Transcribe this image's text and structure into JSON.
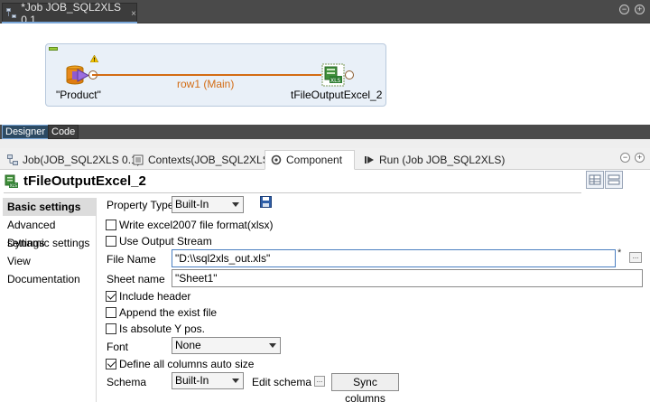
{
  "editor": {
    "tab_title": "*Job JOB_SQL2XLS 0.1",
    "close_glyph": "×",
    "min_glyph": "−",
    "max_glyph": "+"
  },
  "canvas": {
    "source_component": "\"Product\"",
    "target_component": "tFileOutputExcel_2",
    "link_label": "row1 (Main)",
    "link_color": "#d36c14"
  },
  "editor_tabs": [
    "Designer",
    "Code"
  ],
  "views": {
    "tabs": [
      {
        "label": "Job(JOB_SQL2XLS 0.1)",
        "icon": "job-icon"
      },
      {
        "label": "Contexts(JOB_SQL2XLS)",
        "icon": "contexts-icon"
      },
      {
        "label": "Component",
        "icon": "component-icon",
        "active": true
      },
      {
        "label": "Run (Job JOB_SQL2XLS)",
        "icon": "run-icon"
      }
    ],
    "min_glyph": "−",
    "max_glyph": "+"
  },
  "component": {
    "title": "tFileOutputExcel_2"
  },
  "side_tabs": [
    {
      "label": "Basic settings",
      "active": true
    },
    {
      "label": "Advanced settings"
    },
    {
      "label": "Dynamic settings"
    },
    {
      "label": "View"
    },
    {
      "label": "Documentation"
    }
  ],
  "form": {
    "property_type_label": "Property Type",
    "property_type_value": "Built-In",
    "write_excel2007_label": "Write excel2007 file format(xlsx)",
    "write_excel2007_checked": false,
    "use_output_stream_label": "Use Output Stream",
    "use_output_stream_checked": false,
    "file_name_label": "File Name",
    "file_name_value": "\"D:\\\\sql2xls_out.xls\"",
    "required_mark": "*",
    "browse_label": "...",
    "sheet_name_label": "Sheet name",
    "sheet_name_value": "\"Sheet1\"",
    "include_header_label": "Include header",
    "include_header_checked": true,
    "append_exist_label": "Append the exist file",
    "append_exist_checked": false,
    "absolute_y_label": "Is absolute Y pos.",
    "absolute_y_checked": false,
    "font_label": "Font",
    "font_value": "None",
    "define_autosize_label": "Define all columns auto size",
    "define_autosize_checked": true,
    "schema_label": "Schema",
    "schema_value": "Built-In",
    "edit_schema_label": "Edit schema",
    "edit_schema_btn": "...",
    "sync_columns_label": "Sync columns"
  }
}
